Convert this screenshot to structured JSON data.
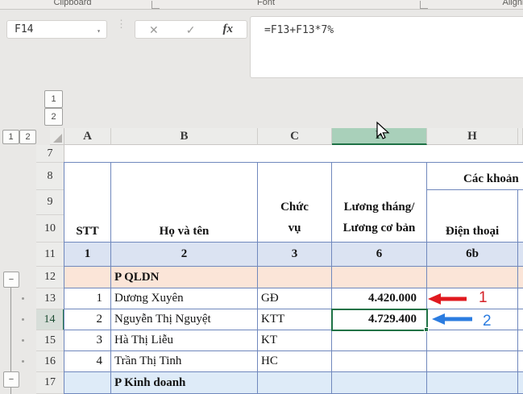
{
  "ribbon": {
    "groups": [
      {
        "label": "Clipboard"
      },
      {
        "label": "Font"
      },
      {
        "label": "Alignment"
      }
    ]
  },
  "formula_bar": {
    "name_box_value": "F14",
    "dropdown_icon": "▾",
    "cancel_icon": "✕",
    "enter_icon": "✓",
    "insert_function_icon": "fx",
    "formula": "=F13+F13*7%"
  },
  "outline": {
    "column_level_buttons": [
      "1",
      "2"
    ],
    "row_level_buttons": [
      "1",
      "2"
    ],
    "group12_collapse": "−",
    "group17_collapse": "−"
  },
  "sheet": {
    "selected_column": "F",
    "active_cell": "F14",
    "columns": [
      "A",
      "B",
      "C",
      "F",
      "H"
    ],
    "row_numbers": [
      "7",
      "8",
      "9",
      "10",
      "11",
      "12",
      "13",
      "14",
      "15",
      "16",
      "17"
    ],
    "headers": {
      "stt": "STT",
      "name": "Họ và tên",
      "role": "Chức\nvụ",
      "salary": "Lương tháng/\nLương cơ bản",
      "deductions": "Các khoản",
      "phone": "Điện thoại"
    },
    "index_row": {
      "a": "1",
      "b": "2",
      "c": "3",
      "f": "6",
      "h": "6b"
    },
    "rows": {
      "r12": {
        "group": "P QLDN"
      },
      "r13": {
        "stt": "1",
        "name": "Dương Xuyên",
        "role": "GĐ",
        "salary": "4.420.000"
      },
      "r14": {
        "stt": "2",
        "name": "Nguyễn Thị Nguyệt",
        "role": "KTT",
        "salary": "4.729.400"
      },
      "r15": {
        "stt": "3",
        "name": "Hà Thị Liễu",
        "role": "KT",
        "salary": ""
      },
      "r16": {
        "stt": "4",
        "name": "Trần Thị Tinh",
        "role": "HC",
        "salary": ""
      },
      "r17": {
        "group": "P Kinh doanh"
      }
    }
  },
  "annotations": {
    "arrow1": {
      "label": "1",
      "color": "#d42027"
    },
    "arrow2": {
      "label": "2",
      "color": "#2b7ce0"
    }
  },
  "colors": {
    "excel_green": "#217346",
    "selected_header_fill": "#a9d0ba",
    "index_row_fill": "#dbe3f2",
    "group_row_fill_qldn": "#fbe5d8",
    "group_row_fill_kinhdoanh": "#deebf8",
    "table_border": "#7088bd"
  }
}
